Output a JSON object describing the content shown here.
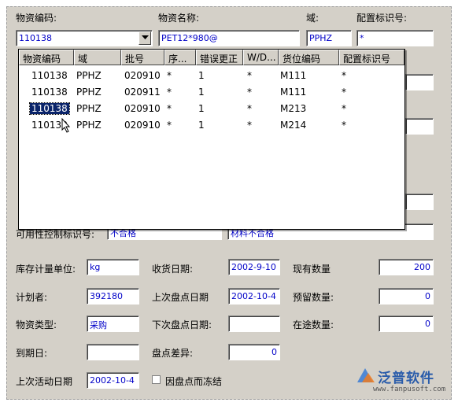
{
  "header": {
    "code_label": "物资编码:",
    "code_value": "110138",
    "name_label": "物资名称:",
    "name_value": "PET12*980@",
    "domain_label": "域:",
    "domain_value": "PPHZ",
    "config_label": "配置标识号:",
    "config_value": "*"
  },
  "dropdown": {
    "columns": [
      "物资编码",
      "域",
      "批号",
      "序...",
      "错误更正",
      "W/D...",
      "货位编码",
      "配置标识号"
    ],
    "rows": [
      [
        "110138",
        "PPHZ",
        "020910",
        "*",
        "1",
        "*",
        "M111",
        "*"
      ],
      [
        "110138",
        "PPHZ",
        "020911",
        "*",
        "1",
        "*",
        "M111",
        "*"
      ],
      [
        "110138",
        "PPHZ",
        "020910",
        "*",
        "1",
        "*",
        "M213",
        "*"
      ],
      [
        "110138",
        "PPHZ",
        "020910",
        "*",
        "1",
        "*",
        "M214",
        "*"
      ]
    ],
    "selected_row": 2
  },
  "partial": {
    "label": "可用性控制标识号:",
    "v1": "不合格",
    "v2": "材料不合格"
  },
  "form": {
    "uom_label": "库存计量单位:",
    "uom_value": "kg",
    "receive_date_label": "收货日期:",
    "receive_date_value": "2002-9-10",
    "onhand_label": "现有数量",
    "onhand_value": "200",
    "planner_label": "计划者:",
    "planner_value": "392180",
    "last_count_label": "上次盘点日期",
    "last_count_value": "2002-10-4",
    "reserved_label": "预留数量:",
    "reserved_value": "0",
    "type_label": "物资类型:",
    "type_value": "采购",
    "next_count_label": "下次盘点日期:",
    "next_count_value": "",
    "intransit_label": "在途数量:",
    "intransit_value": "0",
    "expire_label": "到期日:",
    "expire_value": "",
    "diff_label": "盘点差异:",
    "diff_value": "0",
    "last_activity_label": "上次活动日期",
    "last_activity_value": "2002-10-4",
    "freeze_label": "因盘点而冻结",
    "freeze_checked": false
  },
  "watermark": {
    "brand": "泛普软件",
    "url": "www.fanpusoft.com"
  }
}
